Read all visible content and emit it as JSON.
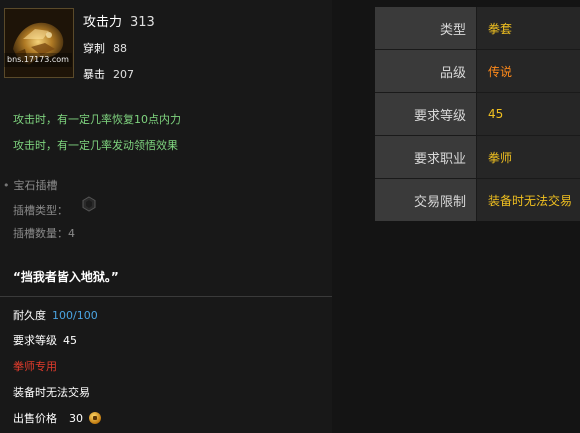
{
  "item": {
    "watermark": "bns.17173.com",
    "stats": [
      {
        "label": "攻击力",
        "value": "313"
      },
      {
        "label": "穿刺",
        "value": "88"
      },
      {
        "label": "暴击",
        "value": "207"
      }
    ],
    "effects": [
      "攻击时，有一定几率恢复10点内力",
      "攻击时，有一定几率发动领悟效果"
    ],
    "gem": {
      "header": "宝石插槽",
      "slot_type_label": "插槽类型：",
      "slot_count_label": "插槽数量：",
      "slot_count": "4"
    },
    "quote": "“挡我者皆入地狱。”",
    "durability_label": "耐久度",
    "durability_value": "100/100",
    "req_level_label": "要求等级",
    "req_level_value": "45",
    "class_only": "拳师专用",
    "trade": "装备时无法交易",
    "price_label": "出售价格",
    "price_value": "30"
  },
  "attributes": [
    {
      "key": "类型",
      "value": "拳套",
      "color": "#f0c020"
    },
    {
      "key": "品级",
      "value": "传说",
      "color": "#ff8a1a"
    },
    {
      "key": "要求等级",
      "value": "45",
      "color": "#f0c020"
    },
    {
      "key": "要求职业",
      "value": "拳师",
      "color": "#f0c020"
    },
    {
      "key": "交易限制",
      "value": "装备时无法交易",
      "color": "#f0c020"
    }
  ]
}
